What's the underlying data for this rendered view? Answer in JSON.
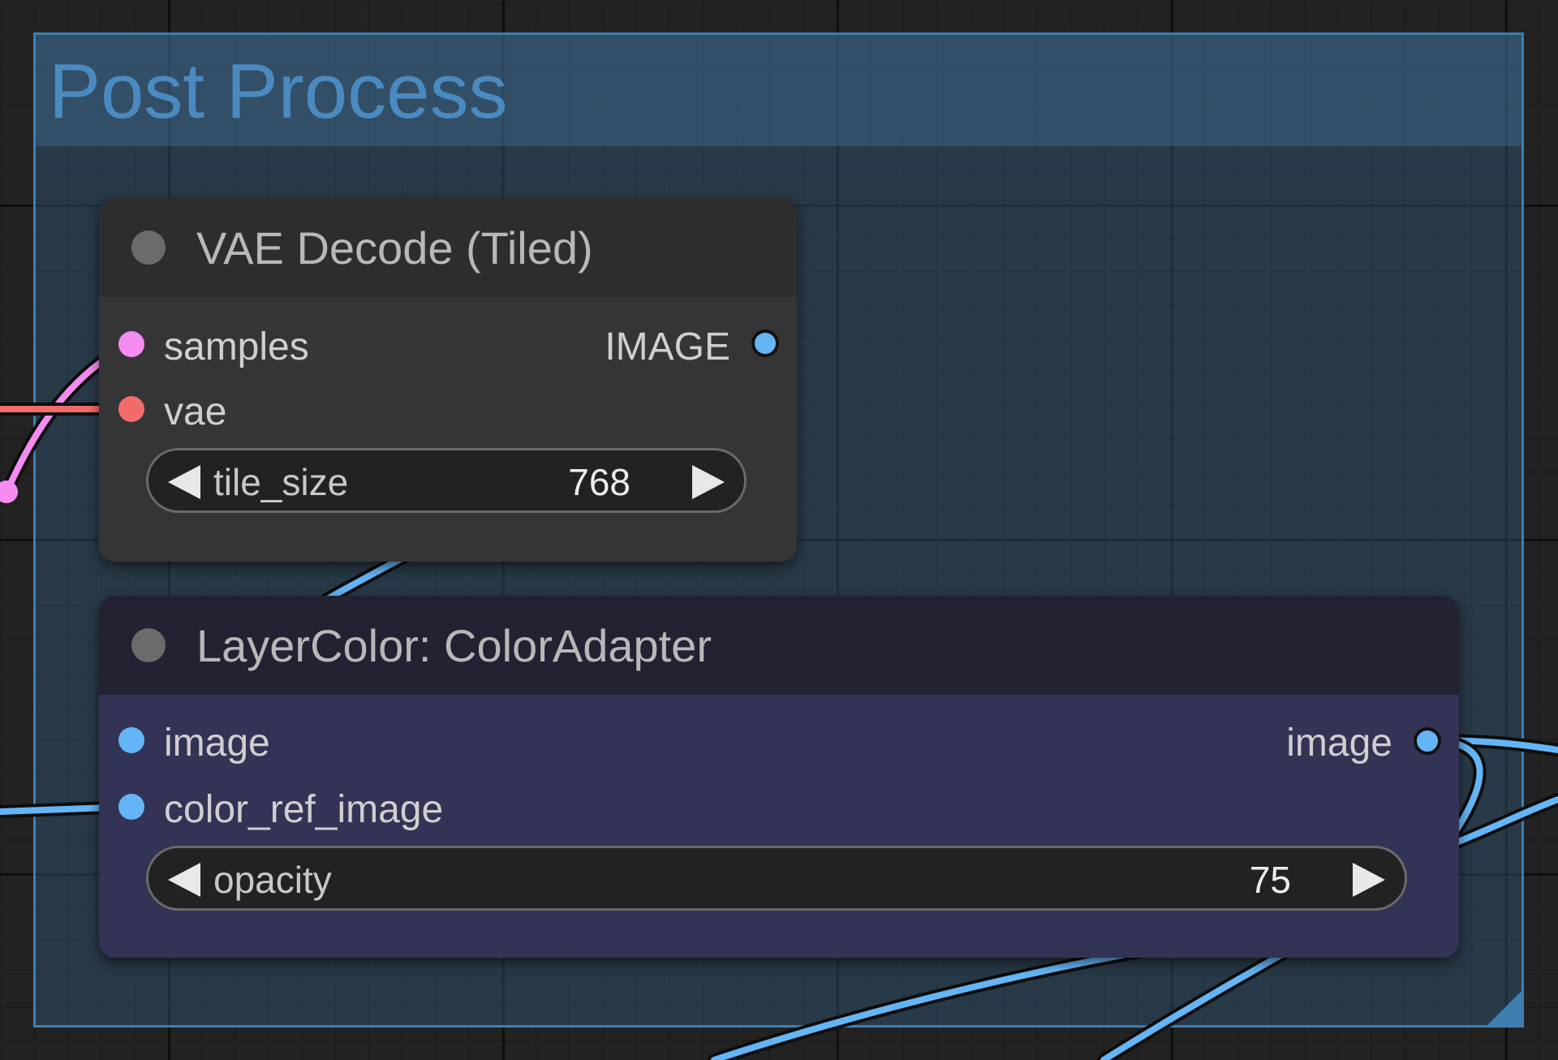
{
  "group": {
    "title": "Post Process",
    "color": "#3f7fb0"
  },
  "vae_decode": {
    "title": "VAE Decode (Tiled)",
    "inputs": [
      {
        "label": "samples",
        "color": "#f58cf2"
      },
      {
        "label": "vae",
        "color": "#f26b6b"
      }
    ],
    "output": {
      "label": "IMAGE",
      "color": "#64b5f6"
    },
    "widget": {
      "label": "tile_size",
      "value": "768"
    }
  },
  "color_adapter": {
    "title": "LayerColor: ColorAdapter",
    "inputs": [
      {
        "label": "image",
        "color": "#64b5f6"
      },
      {
        "label": "color_ref_image",
        "color": "#64b5f6"
      }
    ],
    "output": {
      "label": "image",
      "color": "#64b5f6"
    },
    "widget": {
      "label": "opacity",
      "value": "75"
    }
  },
  "colors": {
    "canvas_bg": "#222222",
    "vae_node_bg": "#353535",
    "vae_header_bg": "#2d2d2d",
    "adapter_node_bg": "#333355",
    "adapter_header_bg": "#222233",
    "image_link": "#64b5f6",
    "latent_link": "#f58cf2",
    "vae_link": "#f26b6b"
  }
}
